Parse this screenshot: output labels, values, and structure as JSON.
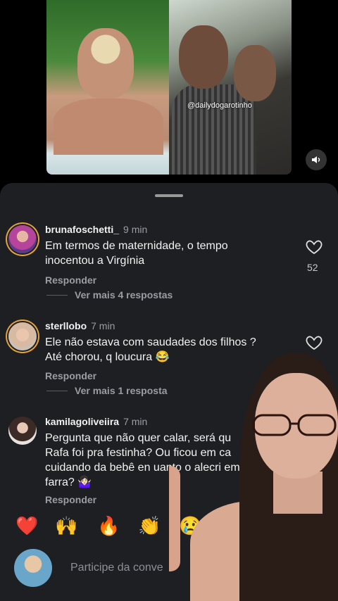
{
  "video": {
    "watermark": "@dailydogarotinho"
  },
  "icons": {
    "sound": "speaker-icon",
    "like": "heart-icon"
  },
  "comments": [
    {
      "username": "bruna​foschetti_",
      "time": "9 min",
      "text": "Em termos de maternidade, o tempo inocentou a Virgínia",
      "reply": "Responder",
      "more": "Ver mais 4 respostas",
      "likes": "52"
    },
    {
      "username": "sterllobo",
      "time": "7 min",
      "text": "Ele não estava com saudades dos filhos ? Até chorou, q loucura 😂",
      "reply": "Responder",
      "more": "Ver mais 1 resposta"
    },
    {
      "username": "kamilagoliveiira",
      "time": "7 min",
      "text": "Pergunta que não quer calar, será qu Rafa foi pra festinha? Ou ficou em ca cuidando da bebê en uanto o alecri em farra? 🤷🏻‍♀️",
      "reply": "Responder"
    }
  ],
  "reactions": [
    "❤️",
    "🙌",
    "🔥",
    "👏",
    "😢"
  ],
  "input": {
    "placeholder": "Participe da conve"
  },
  "colors": {
    "sheet": "#1d1f22",
    "story_ring": "#e3a23b",
    "secondary_text": "#9a9da2"
  }
}
